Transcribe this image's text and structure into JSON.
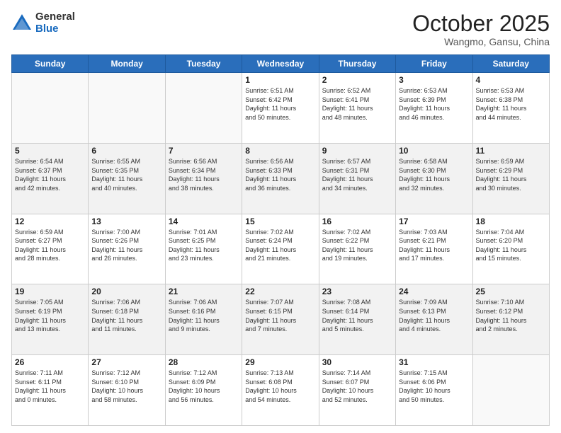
{
  "logo": {
    "general": "General",
    "blue": "Blue"
  },
  "header": {
    "month": "October 2025",
    "location": "Wangmo, Gansu, China"
  },
  "days_of_week": [
    "Sunday",
    "Monday",
    "Tuesday",
    "Wednesday",
    "Thursday",
    "Friday",
    "Saturday"
  ],
  "weeks": [
    [
      {
        "day": "",
        "info": ""
      },
      {
        "day": "",
        "info": ""
      },
      {
        "day": "",
        "info": ""
      },
      {
        "day": "1",
        "info": "Sunrise: 6:51 AM\nSunset: 6:42 PM\nDaylight: 11 hours\nand 50 minutes."
      },
      {
        "day": "2",
        "info": "Sunrise: 6:52 AM\nSunset: 6:41 PM\nDaylight: 11 hours\nand 48 minutes."
      },
      {
        "day": "3",
        "info": "Sunrise: 6:53 AM\nSunset: 6:39 PM\nDaylight: 11 hours\nand 46 minutes."
      },
      {
        "day": "4",
        "info": "Sunrise: 6:53 AM\nSunset: 6:38 PM\nDaylight: 11 hours\nand 44 minutes."
      }
    ],
    [
      {
        "day": "5",
        "info": "Sunrise: 6:54 AM\nSunset: 6:37 PM\nDaylight: 11 hours\nand 42 minutes."
      },
      {
        "day": "6",
        "info": "Sunrise: 6:55 AM\nSunset: 6:35 PM\nDaylight: 11 hours\nand 40 minutes."
      },
      {
        "day": "7",
        "info": "Sunrise: 6:56 AM\nSunset: 6:34 PM\nDaylight: 11 hours\nand 38 minutes."
      },
      {
        "day": "8",
        "info": "Sunrise: 6:56 AM\nSunset: 6:33 PM\nDaylight: 11 hours\nand 36 minutes."
      },
      {
        "day": "9",
        "info": "Sunrise: 6:57 AM\nSunset: 6:31 PM\nDaylight: 11 hours\nand 34 minutes."
      },
      {
        "day": "10",
        "info": "Sunrise: 6:58 AM\nSunset: 6:30 PM\nDaylight: 11 hours\nand 32 minutes."
      },
      {
        "day": "11",
        "info": "Sunrise: 6:59 AM\nSunset: 6:29 PM\nDaylight: 11 hours\nand 30 minutes."
      }
    ],
    [
      {
        "day": "12",
        "info": "Sunrise: 6:59 AM\nSunset: 6:27 PM\nDaylight: 11 hours\nand 28 minutes."
      },
      {
        "day": "13",
        "info": "Sunrise: 7:00 AM\nSunset: 6:26 PM\nDaylight: 11 hours\nand 26 minutes."
      },
      {
        "day": "14",
        "info": "Sunrise: 7:01 AM\nSunset: 6:25 PM\nDaylight: 11 hours\nand 23 minutes."
      },
      {
        "day": "15",
        "info": "Sunrise: 7:02 AM\nSunset: 6:24 PM\nDaylight: 11 hours\nand 21 minutes."
      },
      {
        "day": "16",
        "info": "Sunrise: 7:02 AM\nSunset: 6:22 PM\nDaylight: 11 hours\nand 19 minutes."
      },
      {
        "day": "17",
        "info": "Sunrise: 7:03 AM\nSunset: 6:21 PM\nDaylight: 11 hours\nand 17 minutes."
      },
      {
        "day": "18",
        "info": "Sunrise: 7:04 AM\nSunset: 6:20 PM\nDaylight: 11 hours\nand 15 minutes."
      }
    ],
    [
      {
        "day": "19",
        "info": "Sunrise: 7:05 AM\nSunset: 6:19 PM\nDaylight: 11 hours\nand 13 minutes."
      },
      {
        "day": "20",
        "info": "Sunrise: 7:06 AM\nSunset: 6:18 PM\nDaylight: 11 hours\nand 11 minutes."
      },
      {
        "day": "21",
        "info": "Sunrise: 7:06 AM\nSunset: 6:16 PM\nDaylight: 11 hours\nand 9 minutes."
      },
      {
        "day": "22",
        "info": "Sunrise: 7:07 AM\nSunset: 6:15 PM\nDaylight: 11 hours\nand 7 minutes."
      },
      {
        "day": "23",
        "info": "Sunrise: 7:08 AM\nSunset: 6:14 PM\nDaylight: 11 hours\nand 5 minutes."
      },
      {
        "day": "24",
        "info": "Sunrise: 7:09 AM\nSunset: 6:13 PM\nDaylight: 11 hours\nand 4 minutes."
      },
      {
        "day": "25",
        "info": "Sunrise: 7:10 AM\nSunset: 6:12 PM\nDaylight: 11 hours\nand 2 minutes."
      }
    ],
    [
      {
        "day": "26",
        "info": "Sunrise: 7:11 AM\nSunset: 6:11 PM\nDaylight: 11 hours\nand 0 minutes."
      },
      {
        "day": "27",
        "info": "Sunrise: 7:12 AM\nSunset: 6:10 PM\nDaylight: 10 hours\nand 58 minutes."
      },
      {
        "day": "28",
        "info": "Sunrise: 7:12 AM\nSunset: 6:09 PM\nDaylight: 10 hours\nand 56 minutes."
      },
      {
        "day": "29",
        "info": "Sunrise: 7:13 AM\nSunset: 6:08 PM\nDaylight: 10 hours\nand 54 minutes."
      },
      {
        "day": "30",
        "info": "Sunrise: 7:14 AM\nSunset: 6:07 PM\nDaylight: 10 hours\nand 52 minutes."
      },
      {
        "day": "31",
        "info": "Sunrise: 7:15 AM\nSunset: 6:06 PM\nDaylight: 10 hours\nand 50 minutes."
      },
      {
        "day": "",
        "info": ""
      }
    ]
  ]
}
